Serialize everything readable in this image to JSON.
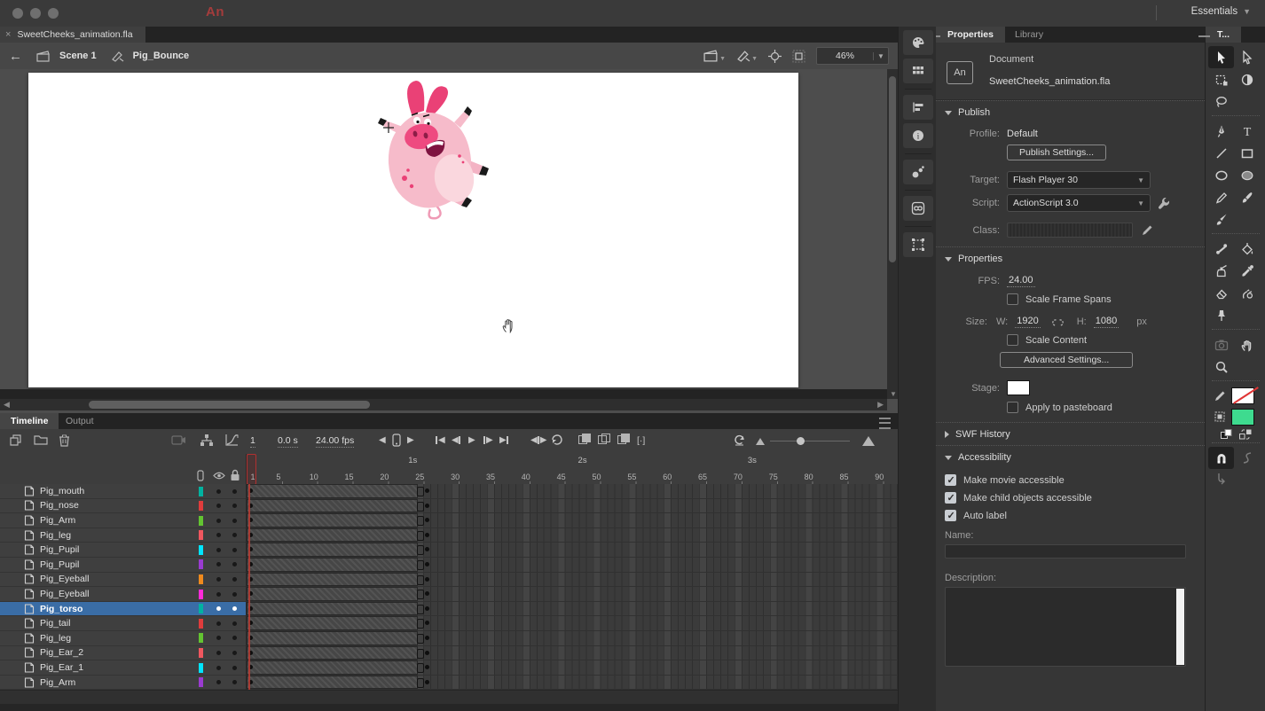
{
  "top_bar": {
    "logo": "An",
    "workspace": "Essentials"
  },
  "doc_tab": {
    "label": "SweetCheeks_animation.fla",
    "close_glyph": "×"
  },
  "edit_bar": {
    "scene": "Scene 1",
    "symbol": "Pig_Bounce",
    "zoom": "46%"
  },
  "stage": {
    "canvas_color": "#ffffff"
  },
  "timeline": {
    "tabs": [
      "Timeline",
      "Output"
    ],
    "toolbar": {
      "current_frame": "1",
      "elapsed_time": "0.0 s",
      "frame_rate": "24.00 fps"
    },
    "ruler": {
      "seconds": [
        {
          "label": "1s",
          "frame": 24
        },
        {
          "label": "2s",
          "frame": 48
        },
        {
          "label": "3s",
          "frame": 72
        }
      ],
      "frames": [
        1,
        5,
        10,
        15,
        20,
        25,
        30,
        35,
        40,
        45,
        50,
        55,
        60,
        65,
        70,
        75,
        80,
        85,
        90
      ]
    },
    "keyframes": {
      "start_frame": 1,
      "span_end_frame": 25,
      "next_keyframe_frame": 26
    },
    "layers": [
      {
        "name": "Pig_mouth",
        "color": "#00b2a0",
        "selected": false
      },
      {
        "name": "Pig_nose",
        "color": "#e03c3c",
        "selected": false
      },
      {
        "name": "Pig_Arm",
        "color": "#63c431",
        "selected": false
      },
      {
        "name": "Pig_leg",
        "color": "#f0575f",
        "selected": false
      },
      {
        "name": "Pig_Pupil",
        "color": "#00e5ff",
        "selected": false
      },
      {
        "name": "Pig_Pupil",
        "color": "#9a3bd0",
        "selected": false
      },
      {
        "name": "Pig_Eyeball",
        "color": "#f08a1d",
        "selected": false
      },
      {
        "name": "Pig_Eyeball",
        "color": "#ff2bd9",
        "selected": false
      },
      {
        "name": "Pig_torso",
        "color": "#00b2a0",
        "selected": true
      },
      {
        "name": "Pig_tail",
        "color": "#e03c3c",
        "selected": false
      },
      {
        "name": "Pig_leg",
        "color": "#63c431",
        "selected": false
      },
      {
        "name": "Pig_Ear_2",
        "color": "#f0575f",
        "selected": false
      },
      {
        "name": "Pig_Ear_1",
        "color": "#00e5ff",
        "selected": false
      },
      {
        "name": "Pig_Arm",
        "color": "#9a3bd0",
        "selected": false
      }
    ]
  },
  "properties": {
    "tabs": [
      "Properties",
      "Library"
    ],
    "document": {
      "badge": "An",
      "kind": "Document",
      "filename": "SweetCheeks_animation.fla"
    },
    "publish": {
      "section": "Publish",
      "profile_label": "Profile:",
      "profile": "Default",
      "publish_settings_button": "Publish Settings...",
      "target_label": "Target:",
      "target": "Flash Player 30",
      "script_label": "Script:",
      "script": "ActionScript 3.0",
      "class_label": "Class:",
      "class_value": ""
    },
    "doc_props": {
      "section": "Properties",
      "fps_label": "FPS:",
      "fps": "24.00",
      "scale_frame_spans_label": "Scale Frame Spans",
      "scale_frame_spans_checked": false,
      "size_label": "Size:",
      "w_label": "W:",
      "width": "1920",
      "h_label": "H:",
      "height": "1080",
      "unit": "px",
      "scale_content_label": "Scale Content",
      "scale_content_checked": false,
      "advanced_settings_button": "Advanced Settings...",
      "stage_label": "Stage:",
      "stage_color": "#ffffff",
      "apply_to_pasteboard_label": "Apply to pasteboard",
      "apply_to_pasteboard_checked": false
    },
    "swf_history": {
      "section": "SWF History"
    },
    "accessibility": {
      "section": "Accessibility",
      "options": [
        {
          "label": "Make movie accessible",
          "checked": true
        },
        {
          "label": "Make child objects accessible",
          "checked": true
        },
        {
          "label": "Auto label",
          "checked": true
        }
      ],
      "name_label": "Name:",
      "name_value": "",
      "description_label": "Description:",
      "description_value": ""
    }
  },
  "tools": {
    "tab": "T...",
    "stroke_color": "none",
    "fill_color": "#3edb8f",
    "items": [
      {
        "name": "selection",
        "active": true
      },
      {
        "name": "subselection"
      },
      {
        "name": "free-transform"
      },
      {
        "name": "gradient-transform"
      },
      {
        "name": "lasso"
      },
      {
        "name": "blank"
      },
      {
        "divider": true
      },
      {
        "name": "pen"
      },
      {
        "name": "text"
      },
      {
        "name": "line"
      },
      {
        "name": "rectangle"
      },
      {
        "name": "oval"
      },
      {
        "name": "oval-primitive"
      },
      {
        "name": "pencil"
      },
      {
        "name": "classic-brush"
      },
      {
        "name": "paint-brush"
      },
      {
        "name": "blank"
      },
      {
        "divider": true
      },
      {
        "name": "bone"
      },
      {
        "name": "paint-bucket"
      },
      {
        "name": "ink-bottle"
      },
      {
        "name": "eyedropper"
      },
      {
        "name": "eraser"
      },
      {
        "name": "asset-warp"
      },
      {
        "name": "rotation"
      },
      {
        "name": "blank"
      },
      {
        "divider": true
      },
      {
        "name": "camera",
        "disabled": true
      },
      {
        "name": "hand"
      },
      {
        "name": "zoom"
      },
      {
        "name": "blank"
      }
    ]
  },
  "dock": {
    "items": [
      "color",
      "swatches",
      "align",
      "info",
      "history",
      "cc-libraries",
      "transform"
    ]
  }
}
